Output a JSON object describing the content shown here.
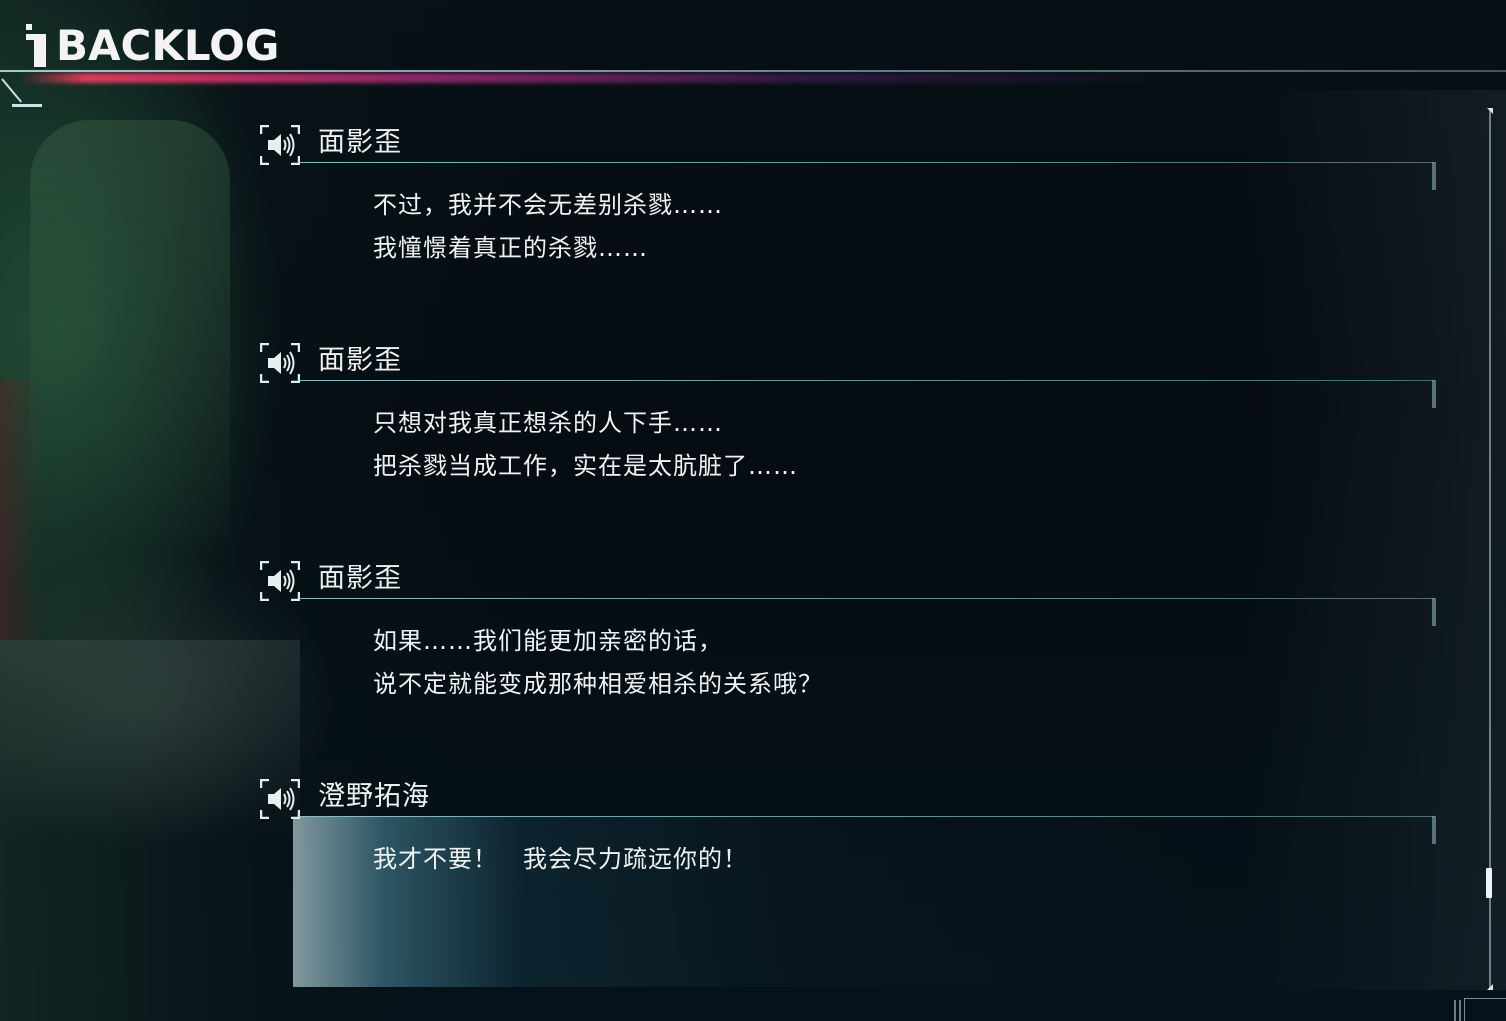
{
  "header": {
    "title": "BACKLOG",
    "icon": "info-icon"
  },
  "colors": {
    "accent_line": "#a6dbe1",
    "accent_glow": "#ff3c64",
    "text": "#eef2f2",
    "background": "#050b10"
  },
  "log": {
    "entries": [
      {
        "speaker": "面影歪",
        "voice_icon": "speaker-icon",
        "lines": [
          "不过，我并不会无差别杀戮……",
          "我憧憬着真正的杀戮……"
        ]
      },
      {
        "speaker": "面影歪",
        "voice_icon": "speaker-icon",
        "lines": [
          "只想对我真正想杀的人下手……",
          "把杀戮当成工作，实在是太肮脏了……"
        ]
      },
      {
        "speaker": "面影歪",
        "voice_icon": "speaker-icon",
        "lines": [
          "如果……我们能更加亲密的话，",
          "说不定就能变成那种相爱相杀的关系哦？"
        ]
      },
      {
        "speaker": "澄野拓海",
        "voice_icon": "speaker-icon",
        "selected": true,
        "lines": [
          "我才不要！　我会尽力疏远你的！"
        ]
      }
    ]
  }
}
